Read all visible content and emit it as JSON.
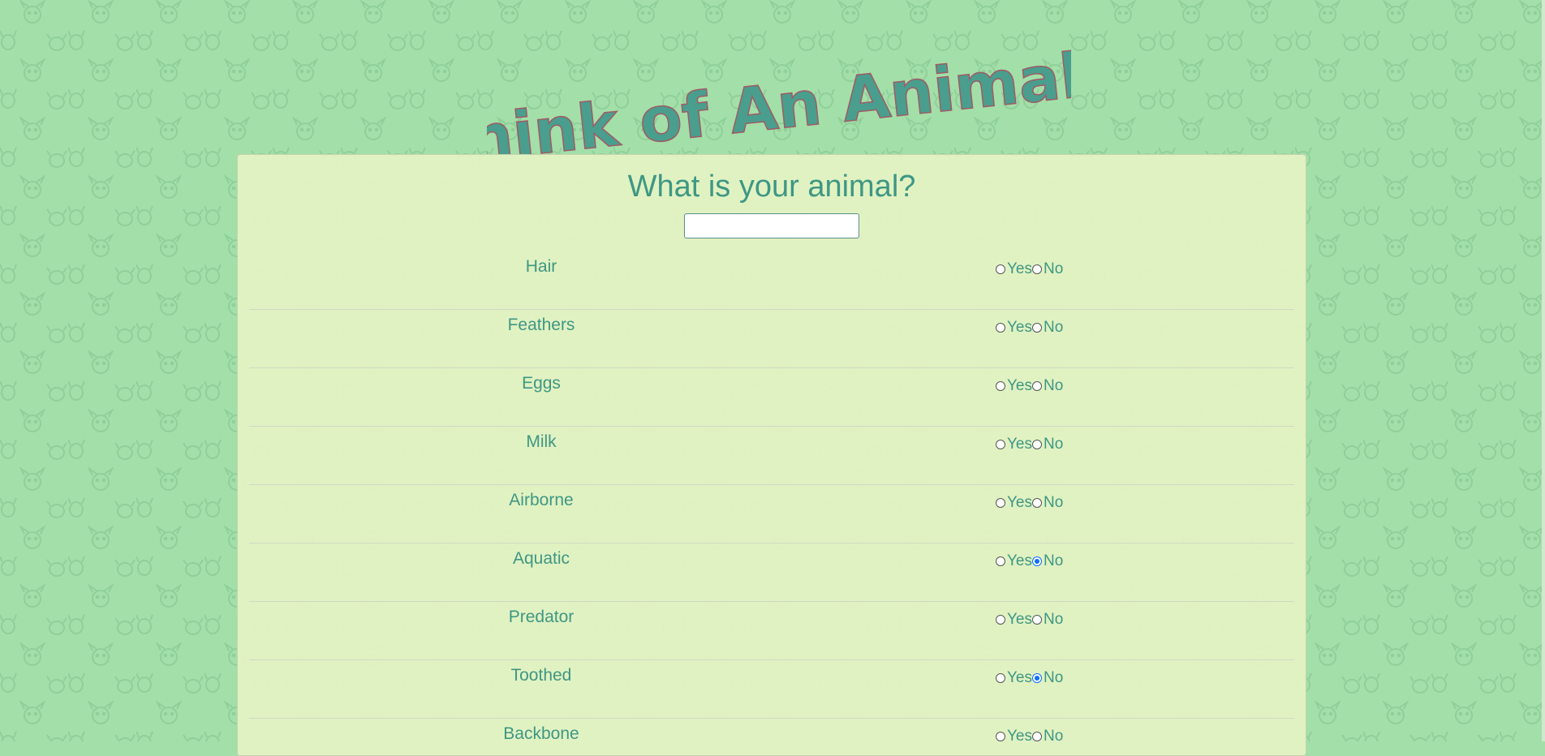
{
  "header": {
    "title": "Think of An Animal !"
  },
  "form": {
    "question": "What is your animal?",
    "input_value": "",
    "input_placeholder": "",
    "yes_label": "Yes",
    "no_label": "No",
    "rows": [
      {
        "label": "Hair",
        "selected": "none"
      },
      {
        "label": "Feathers",
        "selected": "none"
      },
      {
        "label": "Eggs",
        "selected": "none"
      },
      {
        "label": "Milk",
        "selected": "none"
      },
      {
        "label": "Airborne",
        "selected": "none"
      },
      {
        "label": "Aquatic",
        "selected": "no"
      },
      {
        "label": "Predator",
        "selected": "none"
      },
      {
        "label": "Toothed",
        "selected": "no"
      },
      {
        "label": "Backbone",
        "selected": "none"
      }
    ]
  },
  "colors": {
    "background": "#a3dfa8",
    "panel": "#e8f4c4",
    "accent_text": "#3e9784",
    "radio_selected": "#0d6efd"
  }
}
